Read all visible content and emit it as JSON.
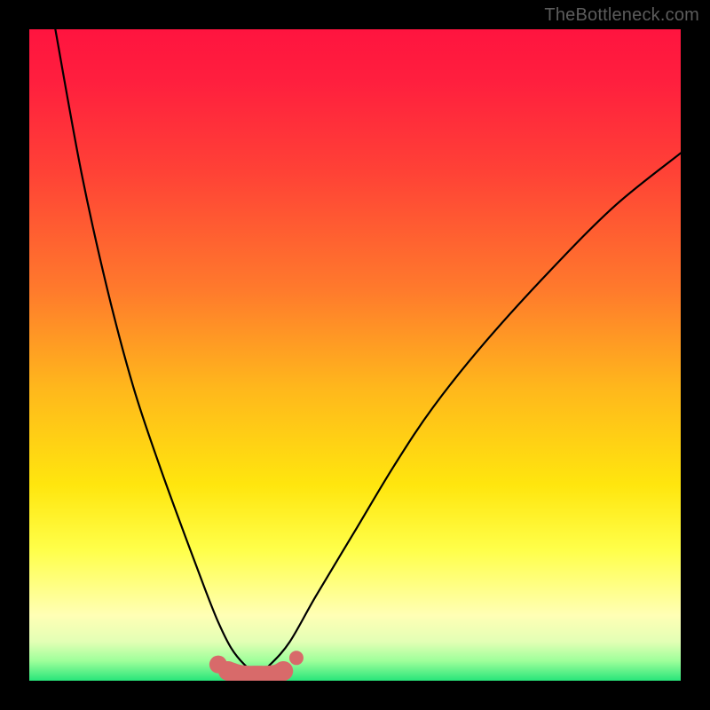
{
  "watermark": "TheBottleneck.com",
  "chart_data": {
    "type": "line",
    "title": "",
    "xlabel": "",
    "ylabel": "",
    "xlim": [
      0,
      100
    ],
    "ylim": [
      0,
      100
    ],
    "grid": false,
    "legend": false,
    "background_gradient": {
      "orientation": "vertical",
      "stops": [
        {
          "pos": 0.0,
          "color": "#ff143f"
        },
        {
          "pos": 0.4,
          "color": "#ff7a2c"
        },
        {
          "pos": 0.7,
          "color": "#ffe60e"
        },
        {
          "pos": 0.9,
          "color": "#ffffb5"
        },
        {
          "pos": 1.0,
          "color": "#28e57a"
        }
      ]
    },
    "series": [
      {
        "name": "bottleneck-curve",
        "color": "#000000",
        "x": [
          4,
          8,
          12,
          16,
          20,
          24,
          27,
          29,
          31,
          33,
          35,
          37,
          40,
          44,
          50,
          56,
          62,
          70,
          80,
          90,
          100
        ],
        "y": [
          100,
          78,
          60,
          45,
          33,
          22,
          14,
          9,
          5,
          2.5,
          1,
          2.5,
          6,
          13,
          23,
          33,
          42,
          52,
          63,
          73,
          81
        ]
      },
      {
        "name": "marker-band",
        "type": "scatter",
        "color": "#d86a6a",
        "marker_size": 12,
        "x": [
          29,
          30.5,
          32,
          33.5,
          35,
          36.5,
          38,
          39,
          41
        ],
        "y": [
          2.5,
          1.5,
          1,
          0.8,
          0.8,
          0.8,
          1,
          1.5,
          3.5
        ]
      }
    ],
    "annotations": []
  }
}
